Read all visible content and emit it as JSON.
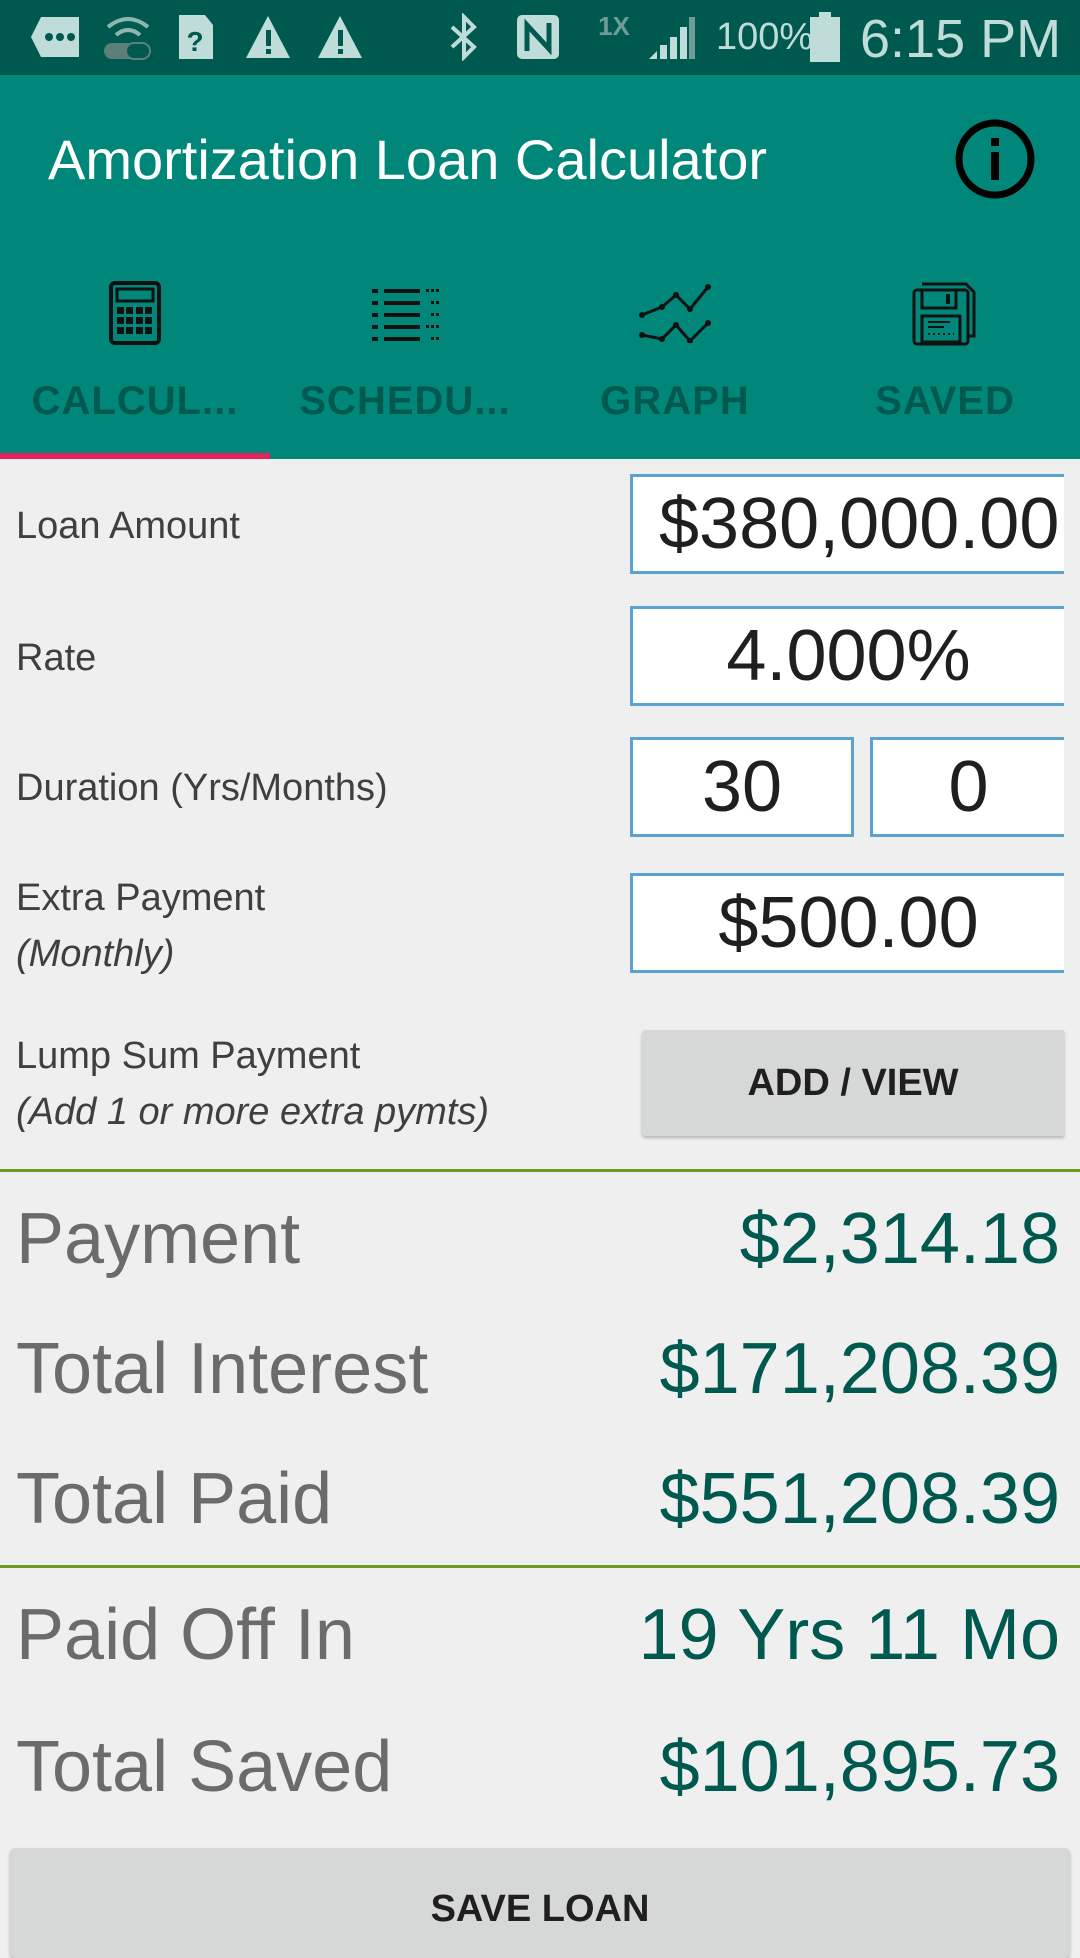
{
  "status_bar": {
    "icons": [
      "message-icon",
      "wifi-toggle-icon",
      "sim-unknown-icon",
      "warning-icon",
      "warning-icon",
      "bluetooth-icon",
      "nfc-icon",
      "1x-network-icon",
      "signal-icon",
      "battery-icon"
    ],
    "network_label": "1X",
    "battery_percent": "100%",
    "time": "6:15 PM"
  },
  "app_bar": {
    "title": "Amortization Loan Calculator",
    "info_icon": "info-icon"
  },
  "tabs": [
    {
      "label": "CALCUL...",
      "icon": "calculator-icon",
      "selected": true
    },
    {
      "label": "SCHEDU...",
      "icon": "list-icon",
      "selected": false
    },
    {
      "label": "GRAPH",
      "icon": "graph-icon",
      "selected": false
    },
    {
      "label": "SAVED",
      "icon": "floppy-disk-icon",
      "selected": false
    }
  ],
  "form": {
    "loan_amount": {
      "label": "Loan Amount",
      "value": "$380,000.00"
    },
    "rate": {
      "label": "Rate",
      "value": "4.000%"
    },
    "duration": {
      "label": "Duration (Yrs/Months)",
      "years": "30",
      "months": "0"
    },
    "extra_payment": {
      "label": "Extra Payment",
      "sublabel": "(Monthly)",
      "value": "$500.00"
    },
    "lump_sum": {
      "label": "Lump Sum Payment",
      "sublabel": "(Add 1 or more extra pymts)",
      "button_label": "ADD / VIEW"
    }
  },
  "results": {
    "payment": {
      "label": "Payment",
      "value": "$2,314.18"
    },
    "total_interest": {
      "label": "Total Interest",
      "value": "$171,208.39"
    },
    "total_paid": {
      "label": "Total Paid",
      "value": "$551,208.39"
    },
    "paid_off_in": {
      "label": "Paid Off In",
      "value": "19 Yrs 11 Mo"
    },
    "total_saved": {
      "label": "Total Saved",
      "value": "$101,895.73"
    }
  },
  "save_button_label": "SAVE LOAN",
  "colors": {
    "status_bar": "#00594f",
    "primary": "#00877a",
    "tab_indicator": "#e0245e",
    "result_value": "#00594f",
    "divider": "#6b9e1f",
    "field_border": "#5ba3cf"
  }
}
